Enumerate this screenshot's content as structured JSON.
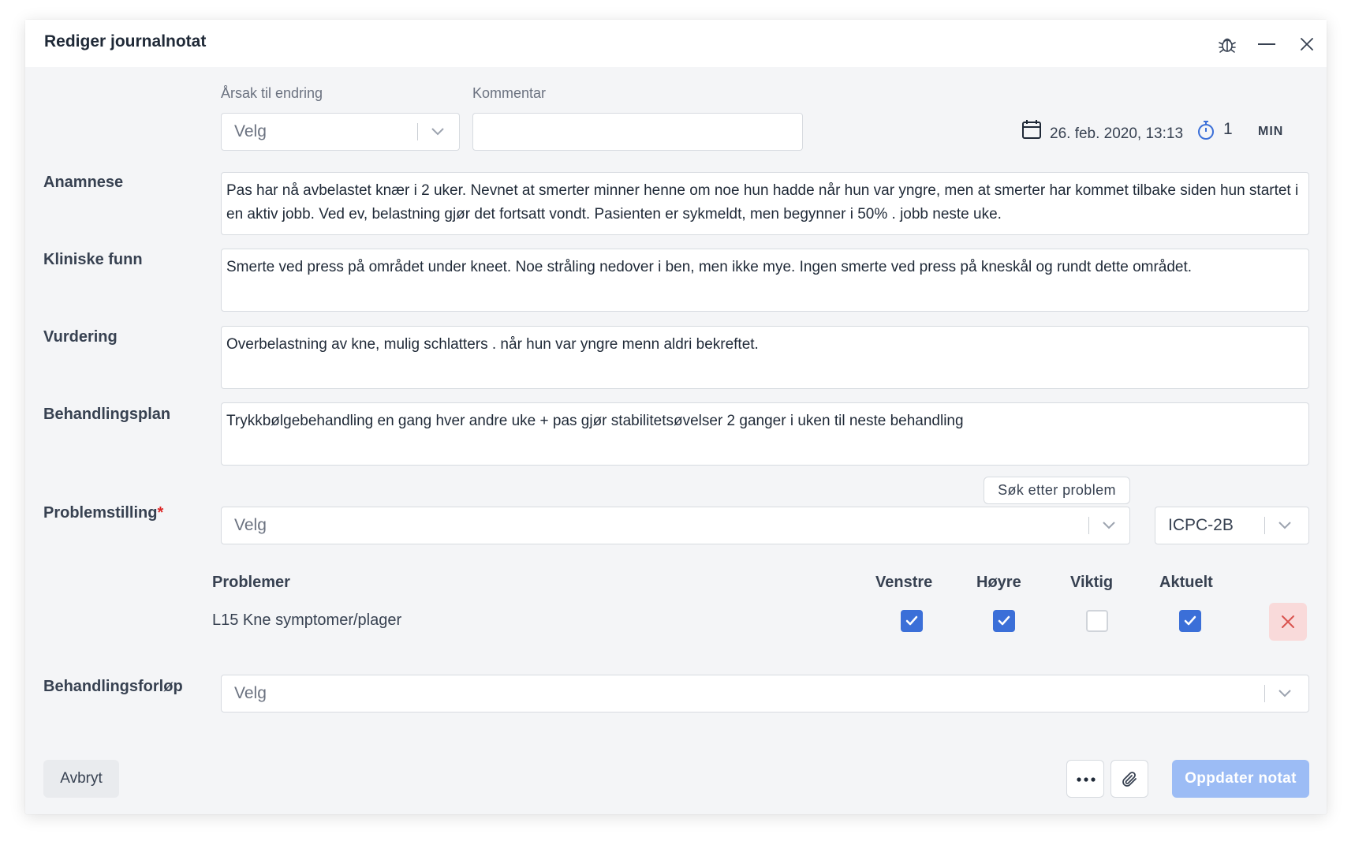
{
  "window": {
    "title": "Rediger journalnotat",
    "icons": [
      "bug-icon",
      "minimize-icon",
      "close-icon"
    ]
  },
  "change": {
    "reason_label": "Årsak til endring",
    "reason_placeholder": "Velg",
    "comment_label": "Kommentar",
    "comment_value": ""
  },
  "meta": {
    "datetime": "26. feb. 2020, 13:13",
    "duration_value": "1",
    "duration_unit": "MIN"
  },
  "sections": {
    "anamnese": {
      "label": "Anamnese",
      "text": "Pas har nå avbelastet knær i 2 uker. Nevnet at smerter minner henne om noe hun hadde når  hun var yngre, men at smerter har kommet tilbake siden hun startet i en aktiv jobb. Ved ev, belastning gjør det fortsatt vondt. Pasienten er sykmeldt, men begynner i 50% . jobb neste uke."
    },
    "kliniske_funn": {
      "label": "Kliniske funn",
      "text": "Smerte ved press på området under kneet. Noe stråling nedover i ben, men ikke mye. Ingen smerte ved press på kneskål og rundt dette området."
    },
    "vurdering": {
      "label": "Vurdering",
      "text": "Overbelastning av kne, mulig schlatters . når hun var yngre menn aldri bekreftet."
    },
    "behandlingsplan": {
      "label": "Behandlingsplan",
      "text": "Trykkbølgebehandling en gang hver andre uke + pas gjør stabilitetsøvelser 2 ganger i uken til neste behandling"
    }
  },
  "problem": {
    "label": "Problemstilling",
    "required_mark": "*",
    "search_button": "Søk etter problem",
    "select_placeholder": "Velg",
    "code_system": "ICPC-2B"
  },
  "problems_table": {
    "headers": {
      "problem": "Problemer",
      "left": "Venstre",
      "right": "Høyre",
      "important": "Viktig",
      "current": "Aktuelt"
    },
    "rows": [
      {
        "name": "L15 Kne symptomer/plager",
        "left": true,
        "right": true,
        "important": false,
        "current": true
      }
    ]
  },
  "course": {
    "label": "Behandlingsforløp",
    "placeholder": "Velg"
  },
  "footer": {
    "cancel": "Avbryt",
    "more_icon": "more-icon",
    "attach_icon": "paperclip-icon",
    "submit": "Oppdater notat"
  },
  "colors": {
    "accent": "#3b6fd8",
    "submit_disabled": "#9cbcf5",
    "delete_bg": "#f9dada",
    "delete_icon": "#d9534f",
    "required": "#dc2626"
  }
}
